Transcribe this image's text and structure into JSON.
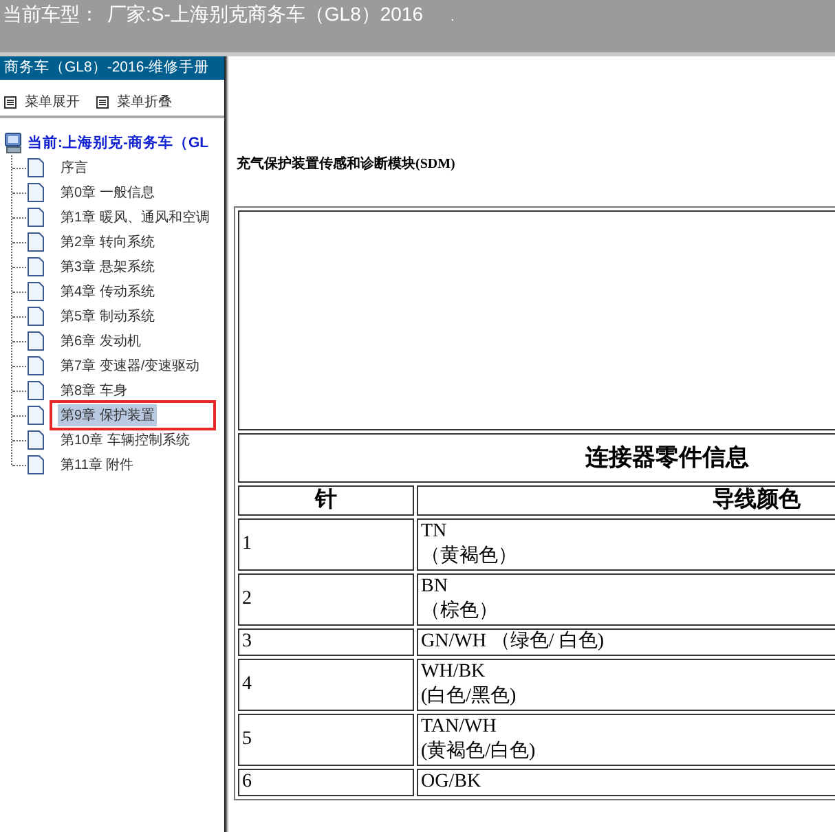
{
  "top_bar": {
    "label": "当前车型：",
    "vehicle": "厂家:S-上海别克商务车（GL8）2016",
    "trailing_mark": "."
  },
  "sidebar": {
    "title": "商务车（GL8）-2016-维修手册",
    "menu_actions": [
      "菜单展开",
      "菜单折叠"
    ],
    "tree": {
      "label": "当前:上海别克-商务车（GL",
      "children": [
        {
          "label": "序言",
          "selected": false
        },
        {
          "label": "第0章 一般信息",
          "selected": false
        },
        {
          "label": "第1章 暖风、通风和空调",
          "selected": false
        },
        {
          "label": "第2章 转向系统",
          "selected": false
        },
        {
          "label": "第3章 悬架系统",
          "selected": false
        },
        {
          "label": "第4章 传动系统",
          "selected": false
        },
        {
          "label": "第5章 制动系统",
          "selected": false
        },
        {
          "label": "第6章 发动机",
          "selected": false
        },
        {
          "label": "第7章 变速器/变速驱动",
          "selected": false
        },
        {
          "label": "第8章 车身",
          "selected": false
        },
        {
          "label": "第9章 保护装置",
          "selected": true
        },
        {
          "label": "第10章 车辆控制系统",
          "selected": false
        },
        {
          "label": "第11章 附件",
          "selected": false
        }
      ]
    }
  },
  "document": {
    "heading": "充气保护装置传感和诊断模块(SDM)",
    "table": {
      "title": "连接器零件信息",
      "columns": [
        "针",
        "导线颜色"
      ],
      "rows": [
        {
          "pin": "1",
          "wire_color": [
            "TN",
            "（黄褐色）"
          ]
        },
        {
          "pin": "2",
          "wire_color": [
            "BN",
            "（棕色）"
          ]
        },
        {
          "pin": "3",
          "wire_color": [
            "GN/WH （绿色/ 白色)"
          ]
        },
        {
          "pin": "4",
          "wire_color": [
            "WH/BK",
            "(白色/黑色)"
          ]
        },
        {
          "pin": "5",
          "wire_color": [
            "TAN/WH",
            "(黄褐色/白色)"
          ]
        },
        {
          "pin": "6",
          "wire_color": [
            "OG/BK"
          ]
        }
      ]
    }
  }
}
